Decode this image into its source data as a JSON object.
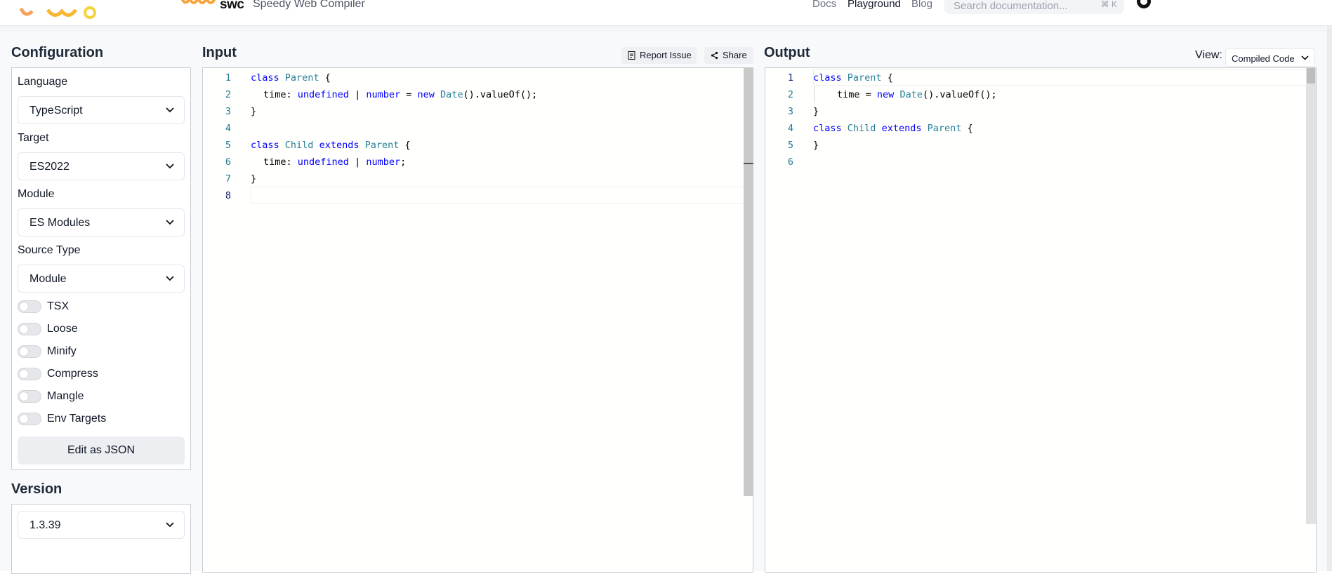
{
  "header": {
    "brand": "swc",
    "subtitle": "Speedy Web Compiler",
    "nav": [
      "Docs",
      "Playground",
      "Blog"
    ],
    "search_placeholder": "Search documentation...",
    "search_shortcut": "⌘ K"
  },
  "config": {
    "title": "Configuration",
    "language_label": "Language",
    "language_value": "TypeScript",
    "target_label": "Target",
    "target_value": "ES2022",
    "module_label": "Module",
    "module_value": "ES Modules",
    "source_type_label": "Source Type",
    "source_type_value": "Module",
    "toggles": [
      "TSX",
      "Loose",
      "Minify",
      "Compress",
      "Mangle",
      "Env Targets"
    ],
    "edit_json_label": "Edit as JSON"
  },
  "version": {
    "title": "Version",
    "value": "1.3.39"
  },
  "input": {
    "title": "Input",
    "report_label": "Report Issue",
    "share_label": "Share",
    "line_numbers": [
      "1",
      "2",
      "3",
      "4",
      "5",
      "6",
      "7",
      "8"
    ]
  },
  "output": {
    "title": "Output",
    "view_label": "View:",
    "view_value": "Compiled Code",
    "line_numbers": [
      "1",
      "2",
      "3",
      "4",
      "5",
      "6"
    ]
  },
  "code": {
    "kw_class": "class",
    "kw_extends": "extends",
    "kw_new": "new",
    "kw_undefined": "undefined",
    "kw_number": "number",
    "id_parent": "Parent",
    "id_child": "Child",
    "id_date": "Date",
    "brace_open": " {",
    "brace_close": "}",
    "time_colon": "time: ",
    "time_eq": "time = ",
    "pipe": " | ",
    "eq": " = ",
    "space": " ",
    "value_of": "().valueOf();",
    "semi": ";"
  },
  "colors": {
    "keyword": "#0000ff",
    "type": "#267f99",
    "line_number": "#237893"
  }
}
